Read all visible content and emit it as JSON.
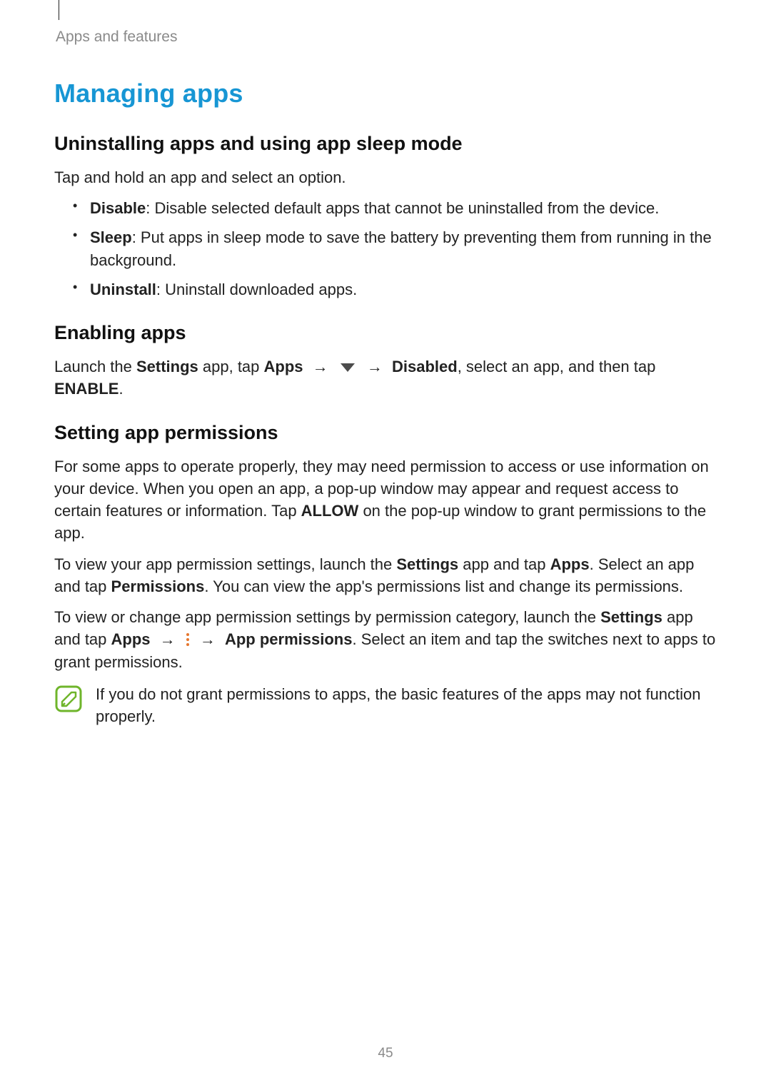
{
  "breadcrumb": "Apps and features",
  "h1": "Managing apps",
  "s1": {
    "heading": "Uninstalling apps and using app sleep mode",
    "intro": "Tap and hold an app and select an option.",
    "bullets": [
      {
        "term": "Disable",
        "desc": ": Disable selected default apps that cannot be uninstalled from the device."
      },
      {
        "term": "Sleep",
        "desc": ": Put apps in sleep mode to save the battery by preventing them from running in the background."
      },
      {
        "term": "Uninstall",
        "desc": ": Uninstall downloaded apps."
      }
    ]
  },
  "s2": {
    "heading": "Enabling apps",
    "p": {
      "t1": "Launch the ",
      "settings": "Settings",
      "t2": " app, tap ",
      "apps": "Apps",
      "arrow1": " → ",
      "arrow2": " → ",
      "disabled": "Disabled",
      "t3": ", select an app, and then tap ",
      "enable": "ENABLE",
      "t4": "."
    }
  },
  "s3": {
    "heading": "Setting app permissions",
    "p1": {
      "t1": "For some apps to operate properly, they may need permission to access or use information on your device. When you open an app, a pop-up window may appear and request access to certain features or information. Tap ",
      "allow": "ALLOW",
      "t2": " on the pop-up window to grant permissions to the app."
    },
    "p2": {
      "t1": "To view your app permission settings, launch the ",
      "settings": "Settings",
      "t2": " app and tap ",
      "apps": "Apps",
      "t3": ". Select an app and tap ",
      "permissions": "Permissions",
      "t4": ". You can view the app's permissions list and change its permissions."
    },
    "p3": {
      "t1": "To view or change app permission settings by permission category, launch the ",
      "settings": "Settings",
      "t2": " app and tap ",
      "apps": "Apps",
      "arrow1": " → ",
      "arrow2": " → ",
      "appperm": "App permissions",
      "t3": ". Select an item and tap the switches next to apps to grant permissions."
    },
    "note": "If you do not grant permissions to apps, the basic features of the apps may not function properly."
  },
  "page_number": "45"
}
